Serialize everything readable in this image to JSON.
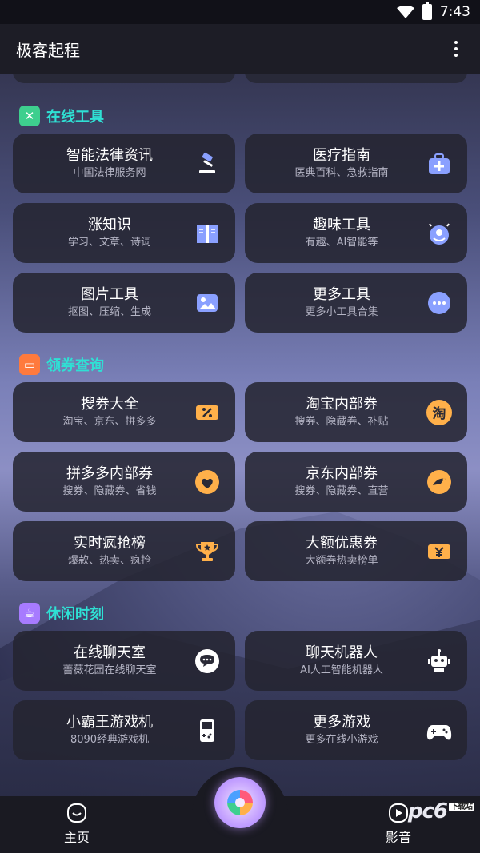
{
  "status": {
    "time": "7:43"
  },
  "app": {
    "title": "极客起程"
  },
  "sections": [
    {
      "title": "在线工具",
      "icon": "tools-icon",
      "color": "#3ecf8e",
      "items": [
        {
          "title": "智能法律资讯",
          "subtitle": "中国法律服务网",
          "icon": "gavel-icon"
        },
        {
          "title": "医疗指南",
          "subtitle": "医典百科、急救指南",
          "icon": "medical-kit-icon"
        },
        {
          "title": "涨知识",
          "subtitle": "学习、文章、诗词",
          "icon": "book-icon"
        },
        {
          "title": "趣味工具",
          "subtitle": "有趣、AI智能等",
          "icon": "fun-face-icon"
        },
        {
          "title": "图片工具",
          "subtitle": "抠图、压缩、生成",
          "icon": "image-icon"
        },
        {
          "title": "更多工具",
          "subtitle": "更多小工具合集",
          "icon": "more-dots-icon"
        }
      ]
    },
    {
      "title": "领券查询",
      "icon": "ticket-icon",
      "color": "#ff7a3d",
      "items": [
        {
          "title": "搜券大全",
          "subtitle": "淘宝、京东、拼多多",
          "icon": "coupon-percent-icon"
        },
        {
          "title": "淘宝内部券",
          "subtitle": "搜券、隐藏券、补贴",
          "icon": "taobao-icon",
          "glyph": "淘"
        },
        {
          "title": "拼多多内部券",
          "subtitle": "搜券、隐藏券、省钱",
          "icon": "pinduoduo-icon"
        },
        {
          "title": "京东内部券",
          "subtitle": "搜券、隐藏券、直营",
          "icon": "jd-icon"
        },
        {
          "title": "实时疯抢榜",
          "subtitle": "爆款、热卖、疯抢",
          "icon": "trophy-icon"
        },
        {
          "title": "大额优惠券",
          "subtitle": "大额券热卖榜单",
          "icon": "yen-coupon-icon"
        }
      ]
    },
    {
      "title": "休闲时刻",
      "icon": "coffee-icon",
      "color": "#a77bff",
      "items": [
        {
          "title": "在线聊天室",
          "subtitle": "蔷薇花园在线聊天室",
          "icon": "chat-bubble-icon"
        },
        {
          "title": "聊天机器人",
          "subtitle": "AI人工智能机器人",
          "icon": "robot-icon"
        },
        {
          "title": "小霸王游戏机",
          "subtitle": "8090经典游戏机",
          "icon": "gameboy-icon"
        },
        {
          "title": "更多游戏",
          "subtitle": "更多在线小游戏",
          "icon": "gamepad-icon"
        }
      ]
    }
  ],
  "nav": {
    "home_label": "主页",
    "video_label": "影音"
  },
  "watermark": {
    "text": "pc6",
    "tag": "下载站"
  },
  "colors": {
    "accent": "#2fe0d4",
    "icon_blue": "#8aa0ff",
    "icon_orange": "#ffb04a"
  }
}
